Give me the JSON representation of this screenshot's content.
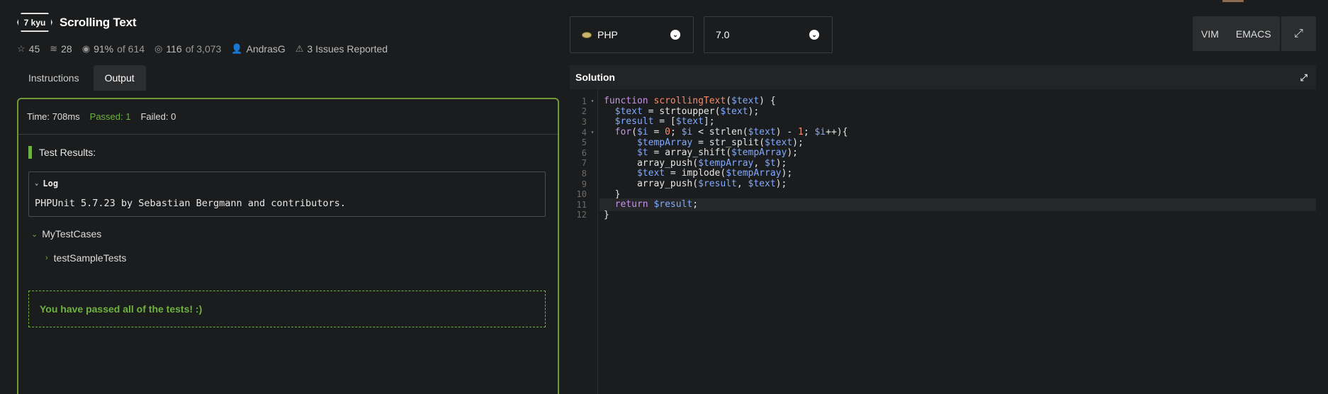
{
  "kata": {
    "rank": "7 kyu",
    "title": "Scrolling Text",
    "stats": {
      "stars": "45",
      "collections": "28",
      "satisfaction": "91%",
      "satisfaction_of": "of 614",
      "completed": "116",
      "completed_of": "of 3,073",
      "author": "AndrasG",
      "issues": "3 Issues Reported"
    }
  },
  "tabs": [
    {
      "label": "Instructions",
      "active": false
    },
    {
      "label": "Output",
      "active": true
    }
  ],
  "output": {
    "time": "Time: 708ms",
    "passed": "Passed: 1",
    "failed": "Failed: 0",
    "results_header": "Test Results:",
    "log_title": "Log",
    "log_line": "PHPUnit 5.7.23 by Sebastian Bergmann and contributors.",
    "suite": "MyTestCases",
    "case": "testSampleTests",
    "passed_message": "You have passed all of the tests! :)"
  },
  "editor_toolbar": {
    "language": "PHP",
    "version": "7.0",
    "modes": [
      "VIM",
      "EMACS"
    ]
  },
  "solution": {
    "title": "Solution",
    "lines": [
      {
        "n": "1",
        "fold": true,
        "code": "function scrollingText($text) {"
      },
      {
        "n": "2",
        "fold": false,
        "code": "  $text = strtoupper($text);"
      },
      {
        "n": "3",
        "fold": false,
        "code": "  $result = [$text];"
      },
      {
        "n": "4",
        "fold": true,
        "code": "  for($i = 0; $i < strlen($text) - 1; $i++){"
      },
      {
        "n": "5",
        "fold": false,
        "code": "      $tempArray = str_split($text);"
      },
      {
        "n": "6",
        "fold": false,
        "code": "      $t = array_shift($tempArray);"
      },
      {
        "n": "7",
        "fold": false,
        "code": "      array_push($tempArray, $t);"
      },
      {
        "n": "8",
        "fold": false,
        "code": "      $text = implode($tempArray);"
      },
      {
        "n": "9",
        "fold": false,
        "code": "      array_push($result, $text);"
      },
      {
        "n": "10",
        "fold": false,
        "code": "  }"
      },
      {
        "n": "11",
        "fold": false,
        "code": "  return $result;"
      },
      {
        "n": "12",
        "fold": false,
        "code": "}"
      }
    ]
  },
  "colors": {
    "accent_green": "#6cb33f",
    "keyword": "#c792ea",
    "variable": "#82aaff",
    "function_name": "#f78c6c",
    "number": "#f78c6c"
  }
}
